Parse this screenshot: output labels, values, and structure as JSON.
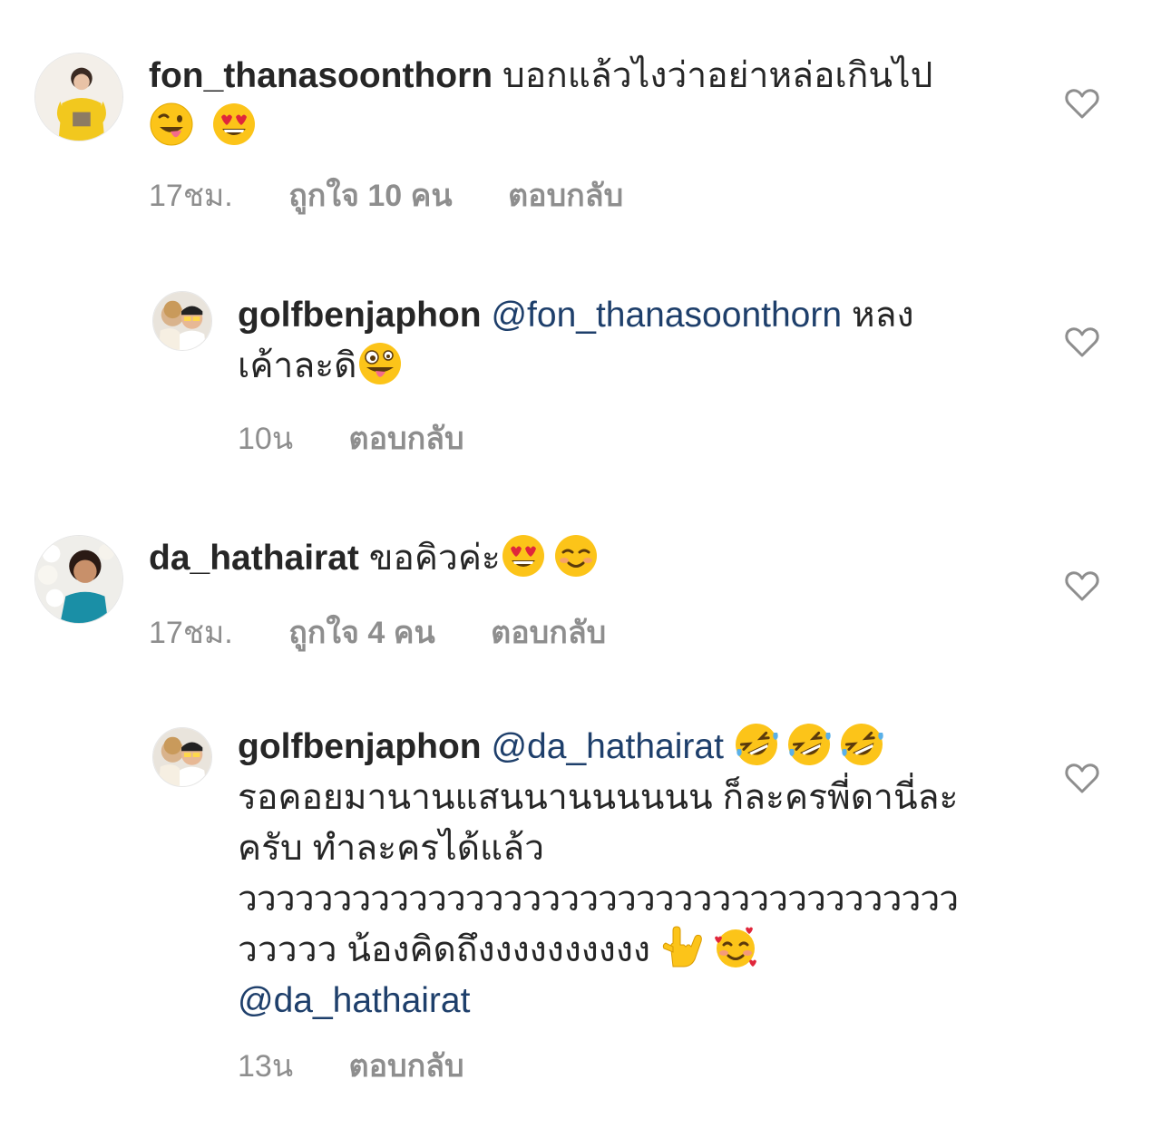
{
  "comments": [
    {
      "username": "fon_thanasoonthorn",
      "text": "บอกแล้วไงว่าอย่าหล่อเกินไป",
      "emojis": [
        "winking-tongue-face",
        "heart-eyes-face"
      ],
      "time": "17ชม.",
      "likes": "ถูกใจ 10 คน",
      "reply": "ตอบกลับ"
    },
    {
      "username": "golfbenjaphon",
      "mention": "@fon_thanasoonthorn",
      "text_line1": "หลง",
      "text_line2": "เค้าละดิ",
      "emojis": [
        "zany-face"
      ],
      "time": "10น",
      "reply": "ตอบกลับ"
    },
    {
      "username": "da_hathairat",
      "text": "ขอคิวค่ะ",
      "emojis": [
        "heart-eyes-face",
        "smiling-blush-face"
      ],
      "time": "17ชม.",
      "likes": "ถูกใจ 4 คน",
      "reply": "ตอบกลับ"
    },
    {
      "username": "golfbenjaphon",
      "mention": "@da_hathairat",
      "emojis_line1": [
        "rolling-laughing-face",
        "rolling-laughing-face",
        "rolling-laughing-face"
      ],
      "text_line2": "รอคอยมานานแสนนานนนนนน ก็ละครพี่ดานี่ละ",
      "text_line3": "ครับ ทำละครได้แล้ว",
      "text_line4": "วววววววววววววววววววววววววววววววววววววว",
      "text_line5": "ววววว น้องคิดถึงงงงงงงงงง",
      "emojis_line5": [
        "love-you-gesture",
        "smiling-hearts-face"
      ],
      "mention_end": "@da_hathairat",
      "time": "13น",
      "reply": "ตอบกลับ"
    }
  ],
  "colors": {
    "text": "#262626",
    "meta": "#8e8e8e",
    "mention": "#1e3f6b",
    "heart_outline": "#8e8e8e"
  }
}
